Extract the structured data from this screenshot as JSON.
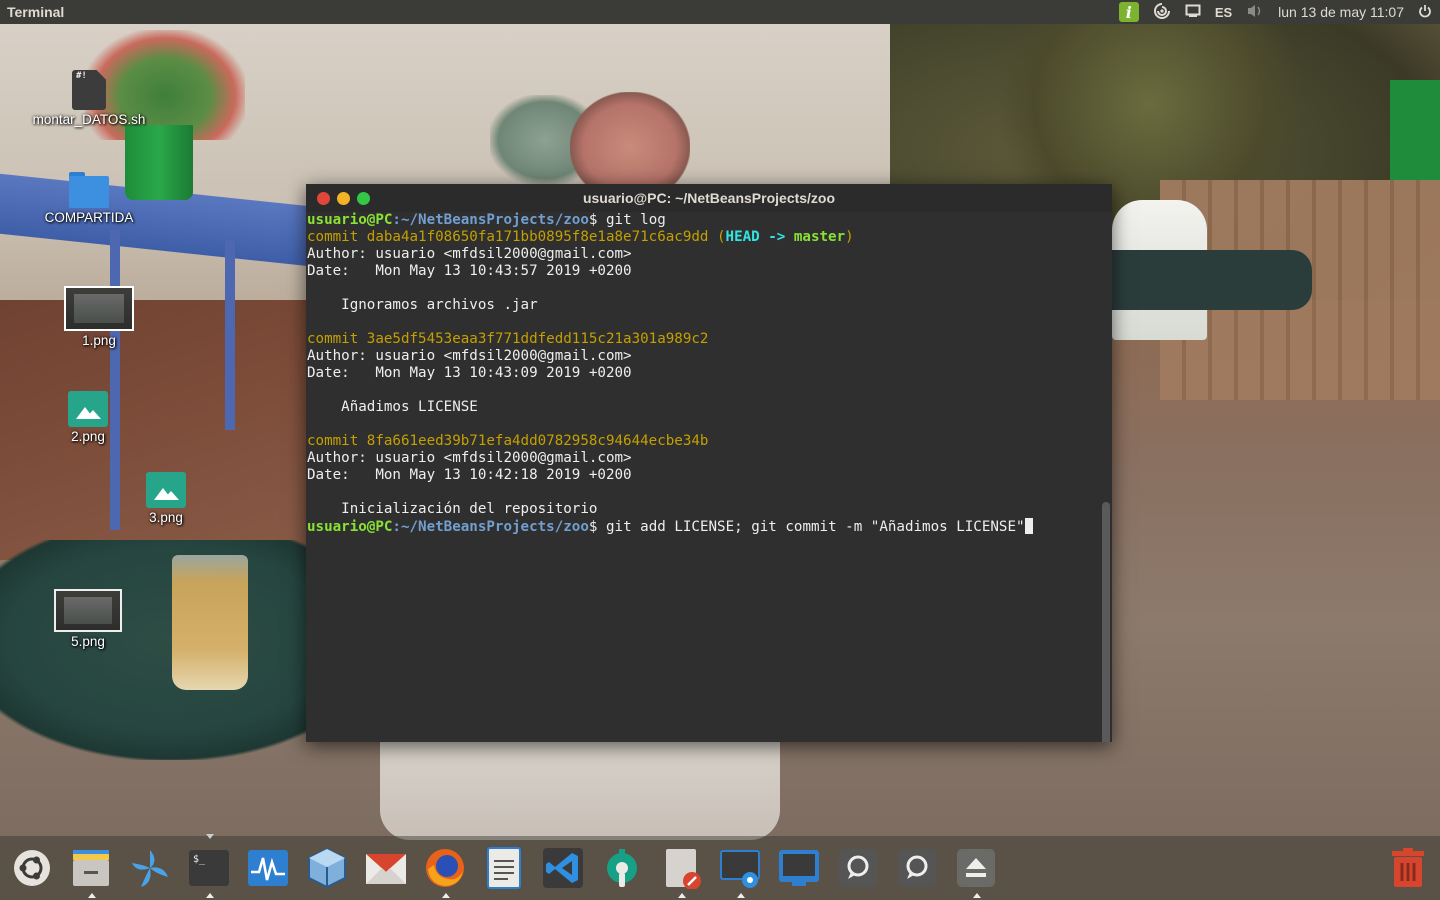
{
  "top_panel": {
    "app_title": "Terminal",
    "language": "ES",
    "clock": "lun 13 de may 11:07",
    "indicators": [
      "info-icon",
      "sync-icon",
      "screen-icon",
      "volume-icon",
      "power-icon"
    ]
  },
  "desktop": {
    "icons": [
      {
        "label": "montar_DATOS.sh",
        "icon": "shell-script-icon",
        "glyph": "#!"
      },
      {
        "label": "COMPARTIDA",
        "icon": "folder-icon"
      },
      {
        "label": "1.png",
        "icon": "image-thumbnail"
      },
      {
        "label": "2.png",
        "icon": "image-file-icon"
      },
      {
        "label": "3.png",
        "icon": "image-file-icon"
      },
      {
        "label": "5.png",
        "icon": "image-thumbnail"
      }
    ]
  },
  "terminal": {
    "title": "usuario@PC: ~/NetBeansProjects/zoo",
    "prompt_user": "usuario@PC",
    "prompt_path": ":~/NetBeansProjects/zoo",
    "prompt_sign": "$ ",
    "cmd1": "git log",
    "commit1": "commit daba4a1f08650fa171bb0895f8e1a8e71c6ac9dd (",
    "head_ref": "HEAD ->",
    "branch": "master",
    "commit1_tail": ")",
    "author1": "Author: usuario <mfdsil2000@gmail.com>",
    "date1": "Date:   Mon May 13 10:43:57 2019 +0200",
    "msg1": "    Ignoramos archivos .jar",
    "commit2": "commit 3ae5df5453eaa3f771ddfedd115c21a301a989c2",
    "author2": "Author: usuario <mfdsil2000@gmail.com>",
    "date2": "Date:   Mon May 13 10:43:09 2019 +0200",
    "msg2": "    Añadimos LICENSE",
    "commit3": "commit 8fa661eed39b71efa4dd0782958c94644ecbe34b",
    "author3": "Author: usuario <mfdsil2000@gmail.com>",
    "date3": "Date:   Mon May 13 10:42:18 2019 +0200",
    "msg3": "    Inicialización del repositorio",
    "cmd2": "git add LICENSE; git commit -m \"Añadimos LICENSE\""
  },
  "dock": {
    "items": [
      "ubuntu-logo-icon",
      "files-icon",
      "shutter-icon",
      "terminal-icon",
      "system-monitor-icon",
      "virtualbox-icon",
      "mail-icon",
      "firefox-icon",
      "text-editor-icon",
      "vscode-icon",
      "settings-icon",
      "drawing-icon",
      "screenshot-icon",
      "remote-desktop-icon",
      "chat-icon",
      "chat-icon-2",
      "eject-icon",
      "trash-icon"
    ]
  },
  "colors": {
    "prompt_user": "#8ae234",
    "prompt_path": "#729fcf",
    "commit_hash": "#c4a000",
    "terminal_bg": "#2f2f2f",
    "panel_bg": "#3b3b38"
  }
}
